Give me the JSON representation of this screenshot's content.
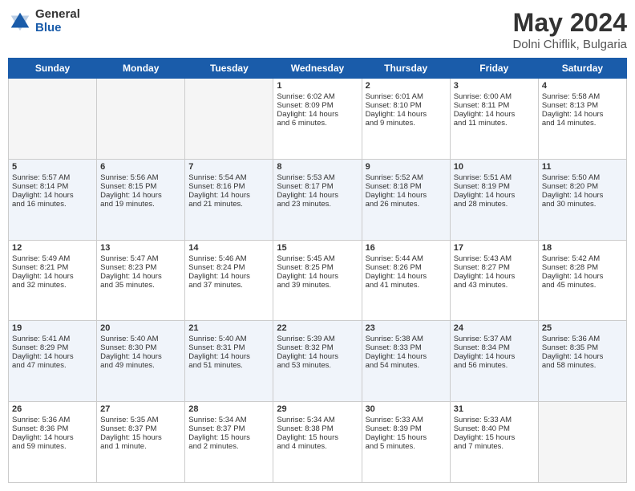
{
  "logo": {
    "general": "General",
    "blue": "Blue"
  },
  "title": {
    "month_year": "May 2024",
    "location": "Dolni Chiflik, Bulgaria"
  },
  "headers": [
    "Sunday",
    "Monday",
    "Tuesday",
    "Wednesday",
    "Thursday",
    "Friday",
    "Saturday"
  ],
  "weeks": [
    [
      {
        "day": "",
        "info": ""
      },
      {
        "day": "",
        "info": ""
      },
      {
        "day": "",
        "info": ""
      },
      {
        "day": "1",
        "info": "Sunrise: 6:02 AM\nSunset: 8:09 PM\nDaylight: 14 hours\nand 6 minutes."
      },
      {
        "day": "2",
        "info": "Sunrise: 6:01 AM\nSunset: 8:10 PM\nDaylight: 14 hours\nand 9 minutes."
      },
      {
        "day": "3",
        "info": "Sunrise: 6:00 AM\nSunset: 8:11 PM\nDaylight: 14 hours\nand 11 minutes."
      },
      {
        "day": "4",
        "info": "Sunrise: 5:58 AM\nSunset: 8:13 PM\nDaylight: 14 hours\nand 14 minutes."
      }
    ],
    [
      {
        "day": "5",
        "info": "Sunrise: 5:57 AM\nSunset: 8:14 PM\nDaylight: 14 hours\nand 16 minutes."
      },
      {
        "day": "6",
        "info": "Sunrise: 5:56 AM\nSunset: 8:15 PM\nDaylight: 14 hours\nand 19 minutes."
      },
      {
        "day": "7",
        "info": "Sunrise: 5:54 AM\nSunset: 8:16 PM\nDaylight: 14 hours\nand 21 minutes."
      },
      {
        "day": "8",
        "info": "Sunrise: 5:53 AM\nSunset: 8:17 PM\nDaylight: 14 hours\nand 23 minutes."
      },
      {
        "day": "9",
        "info": "Sunrise: 5:52 AM\nSunset: 8:18 PM\nDaylight: 14 hours\nand 26 minutes."
      },
      {
        "day": "10",
        "info": "Sunrise: 5:51 AM\nSunset: 8:19 PM\nDaylight: 14 hours\nand 28 minutes."
      },
      {
        "day": "11",
        "info": "Sunrise: 5:50 AM\nSunset: 8:20 PM\nDaylight: 14 hours\nand 30 minutes."
      }
    ],
    [
      {
        "day": "12",
        "info": "Sunrise: 5:49 AM\nSunset: 8:21 PM\nDaylight: 14 hours\nand 32 minutes."
      },
      {
        "day": "13",
        "info": "Sunrise: 5:47 AM\nSunset: 8:23 PM\nDaylight: 14 hours\nand 35 minutes."
      },
      {
        "day": "14",
        "info": "Sunrise: 5:46 AM\nSunset: 8:24 PM\nDaylight: 14 hours\nand 37 minutes."
      },
      {
        "day": "15",
        "info": "Sunrise: 5:45 AM\nSunset: 8:25 PM\nDaylight: 14 hours\nand 39 minutes."
      },
      {
        "day": "16",
        "info": "Sunrise: 5:44 AM\nSunset: 8:26 PM\nDaylight: 14 hours\nand 41 minutes."
      },
      {
        "day": "17",
        "info": "Sunrise: 5:43 AM\nSunset: 8:27 PM\nDaylight: 14 hours\nand 43 minutes."
      },
      {
        "day": "18",
        "info": "Sunrise: 5:42 AM\nSunset: 8:28 PM\nDaylight: 14 hours\nand 45 minutes."
      }
    ],
    [
      {
        "day": "19",
        "info": "Sunrise: 5:41 AM\nSunset: 8:29 PM\nDaylight: 14 hours\nand 47 minutes."
      },
      {
        "day": "20",
        "info": "Sunrise: 5:40 AM\nSunset: 8:30 PM\nDaylight: 14 hours\nand 49 minutes."
      },
      {
        "day": "21",
        "info": "Sunrise: 5:40 AM\nSunset: 8:31 PM\nDaylight: 14 hours\nand 51 minutes."
      },
      {
        "day": "22",
        "info": "Sunrise: 5:39 AM\nSunset: 8:32 PM\nDaylight: 14 hours\nand 53 minutes."
      },
      {
        "day": "23",
        "info": "Sunrise: 5:38 AM\nSunset: 8:33 PM\nDaylight: 14 hours\nand 54 minutes."
      },
      {
        "day": "24",
        "info": "Sunrise: 5:37 AM\nSunset: 8:34 PM\nDaylight: 14 hours\nand 56 minutes."
      },
      {
        "day": "25",
        "info": "Sunrise: 5:36 AM\nSunset: 8:35 PM\nDaylight: 14 hours\nand 58 minutes."
      }
    ],
    [
      {
        "day": "26",
        "info": "Sunrise: 5:36 AM\nSunset: 8:36 PM\nDaylight: 14 hours\nand 59 minutes."
      },
      {
        "day": "27",
        "info": "Sunrise: 5:35 AM\nSunset: 8:37 PM\nDaylight: 15 hours\nand 1 minute."
      },
      {
        "day": "28",
        "info": "Sunrise: 5:34 AM\nSunset: 8:37 PM\nDaylight: 15 hours\nand 2 minutes."
      },
      {
        "day": "29",
        "info": "Sunrise: 5:34 AM\nSunset: 8:38 PM\nDaylight: 15 hours\nand 4 minutes."
      },
      {
        "day": "30",
        "info": "Sunrise: 5:33 AM\nSunset: 8:39 PM\nDaylight: 15 hours\nand 5 minutes."
      },
      {
        "day": "31",
        "info": "Sunrise: 5:33 AM\nSunset: 8:40 PM\nDaylight: 15 hours\nand 7 minutes."
      },
      {
        "day": "",
        "info": ""
      }
    ]
  ]
}
